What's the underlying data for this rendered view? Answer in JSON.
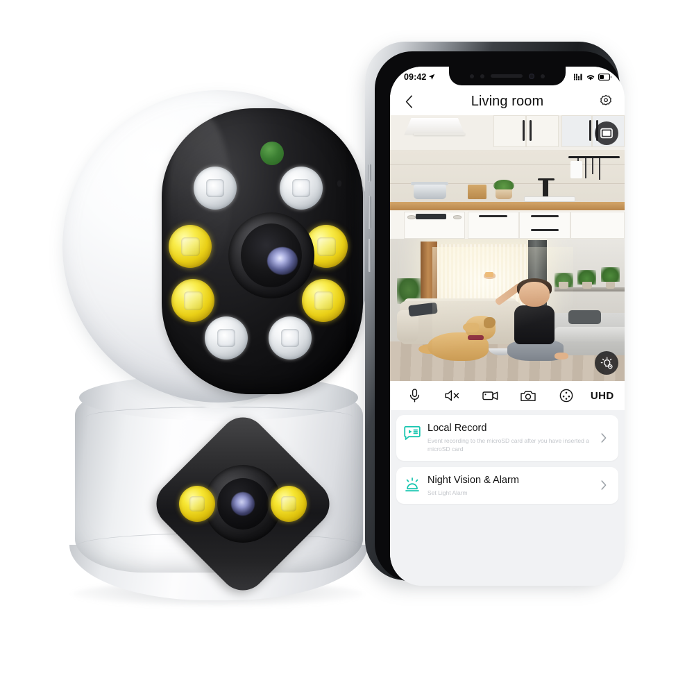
{
  "scene": {
    "title": "Smart Wi-Fi Dual-Lens Pan/Tilt Security Camera with Phone App",
    "background_color": "#ffffff"
  },
  "device": {
    "name": "dual-lens-pan-tilt-camera",
    "body_color": "#ffffff",
    "faceplate_color": "#111113",
    "head": {
      "label": "camera-head",
      "lens_label": "main-lens",
      "sensor_dot_label": "light-sensor",
      "sensor_dot_color": "#3c7f33",
      "white_led_count": 4,
      "yellow_led_count": 4,
      "white_led_color": "#f2f4f6",
      "yellow_led_color": "#f9ec4a"
    },
    "base": {
      "label": "camera-base",
      "module_shape": "diamond",
      "lens_label": "secondary-lens",
      "yellow_led_count": 2
    }
  },
  "phone": {
    "status_bar": {
      "time": "09:42",
      "location_icon": "location-arrow-icon",
      "signal_icon": "cellular-signal-icon",
      "wifi_icon": "wifi-icon",
      "battery_icon": "battery-icon",
      "battery_level_percent": 40
    },
    "header": {
      "back_icon": "back-chevron-icon",
      "title": "Living room",
      "settings_icon": "gear-icon"
    },
    "feeds": [
      {
        "name": "kitchen-feed",
        "description": "Kitchen with white cabinets, wood countertop, range hood, pots and plants",
        "overlay_button": {
          "icon": "picture-in-picture-icon",
          "label": "Swap view"
        }
      },
      {
        "name": "living-room-feed",
        "description": "Boy in black t-shirt holding a treat for a golden retriever dog in a sunlit living room",
        "overlay_button": {
          "icon": "light-settings-icon",
          "label": "Light settings"
        }
      }
    ],
    "control_bar": [
      {
        "name": "microphone",
        "icon": "microphone-icon",
        "label": "Talk"
      },
      {
        "name": "speaker",
        "icon": "speaker-muted-icon",
        "label": "Mute"
      },
      {
        "name": "record",
        "icon": "camcorder-icon",
        "label": "Record"
      },
      {
        "name": "snapshot",
        "icon": "camera-icon",
        "label": "Snapshot"
      },
      {
        "name": "pan-tilt",
        "icon": "pan-tilt-icon",
        "label": "PTZ"
      },
      {
        "name": "quality",
        "icon": "text-label",
        "label": "UHD"
      }
    ],
    "list": [
      {
        "name": "local-record",
        "icon": "local-record-icon",
        "icon_color": "#19c6b0",
        "title": "Local Record",
        "subtitle": "Event recording to the microSD card after you have inserted a microSD card",
        "chevron": "chevron-right-icon"
      },
      {
        "name": "night-vision-alarm",
        "icon": "alarm-light-icon",
        "icon_color": "#19c6b0",
        "title": "Night Vision & Alarm",
        "subtitle": "Set Light Alarm",
        "chevron": "chevron-right-icon"
      }
    ],
    "theme": {
      "accent": "#19c6b0",
      "background": "#f1f2f4",
      "card_background": "#ffffff",
      "title_text": "#111111",
      "subtitle_text": "#c3c6cb"
    }
  }
}
